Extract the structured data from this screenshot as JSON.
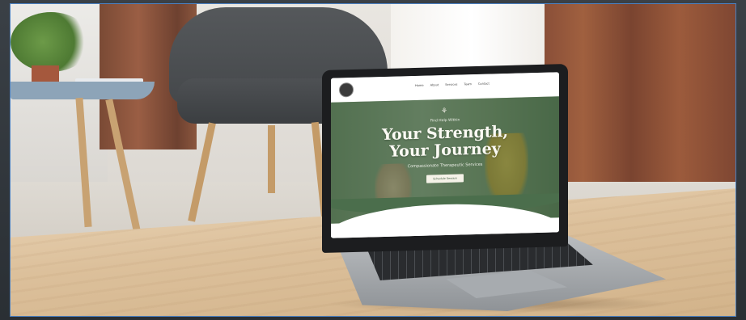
{
  "website": {
    "nav_links": [
      "Home",
      "About",
      "Services",
      "Team",
      "Contact"
    ],
    "hero": {
      "kicker": "Find Help Within",
      "title_line1": "Your Strength,",
      "title_line2": "Your Journey",
      "subtitle": "Compassionate Therapeutic Services",
      "cta_label": "Schedule Session"
    }
  },
  "colors": {
    "hero_green": "#4b6e4c",
    "curtain_rust": "#9a5e44",
    "chair_gray": "#4e5154",
    "desk_wood": "#dcc09b"
  }
}
